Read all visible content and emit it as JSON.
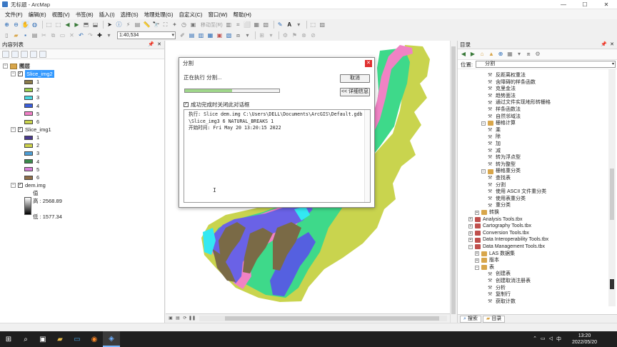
{
  "window": {
    "title": "无标题 - ArcMap",
    "controls": [
      "—",
      "☐",
      "✕"
    ]
  },
  "menu": [
    "文件(F)",
    "编辑(E)",
    "视图(V)",
    "书签(B)",
    "插入(I)",
    "选择(S)",
    "地理处理(G)",
    "自定义(C)",
    "窗口(W)",
    "帮助(H)"
  ],
  "toolbar": {
    "scale": "1:40,534",
    "mover_label": "移动至(R)"
  },
  "toc": {
    "title": "内容列表",
    "root": "图层",
    "layers": [
      {
        "name": "Slice_img2",
        "selected": true,
        "classes": [
          "1",
          "2",
          "3",
          "4",
          "5",
          "6"
        ],
        "colors": [
          "#8b7b4a",
          "#9dcf52",
          "#4ad7e0",
          "#3a5edc",
          "#f280c8",
          "#c9d44e"
        ]
      },
      {
        "name": "Slice_img1",
        "selected": false,
        "classes": [
          "1",
          "2",
          "3",
          "4",
          "5",
          "6"
        ],
        "colors": [
          "#4a3a8f",
          "#cdd24a",
          "#4da0d8",
          "#3a8a4c",
          "#d77ed8",
          "#8f6f48"
        ]
      }
    ],
    "dem": {
      "name": "dem.img",
      "value_label": "值",
      "high": "高 : 2568.89",
      "low": "低 : 1577.34"
    }
  },
  "dialog": {
    "title": "分割",
    "status": "正在执行 分割...",
    "cancel": "取消",
    "details": "<< 详细信息",
    "progress": 0.5,
    "close_on_success": "成功完成时关闭此对话框",
    "log": [
      "执行: Slice dem.img C:\\Users\\DELL\\Documents\\ArcGIS\\Default.gdb",
      "\\Slice_img3 6 NATURAL_BREAKS 1",
      "开始时间: Fri May 20 13:20:15 2022"
    ]
  },
  "catalog": {
    "title": "目录",
    "location_label": "位置:",
    "location_value": "分割",
    "tabs": [
      "搜索",
      "目录"
    ],
    "items": [
      {
        "label": "反距离权重法",
        "kind": "tool",
        "indent": 4
      },
      {
        "label": "含障碍的样条函数",
        "kind": "tool",
        "indent": 4
      },
      {
        "label": "克里金法",
        "kind": "tool",
        "indent": 4
      },
      {
        "label": "趋势面法",
        "kind": "tool",
        "indent": 4
      },
      {
        "label": "通过文件实现地形转栅格",
        "kind": "tool",
        "indent": 4
      },
      {
        "label": "样条函数法",
        "kind": "tool",
        "indent": 4
      },
      {
        "label": "自然邻域法",
        "kind": "tool",
        "indent": 4
      },
      {
        "label": "栅格计算",
        "kind": "set",
        "indent": 3,
        "exp": "−"
      },
      {
        "label": "乘",
        "kind": "tool",
        "indent": 4
      },
      {
        "label": "除",
        "kind": "tool",
        "indent": 4
      },
      {
        "label": "加",
        "kind": "tool",
        "indent": 4
      },
      {
        "label": "减",
        "kind": "tool",
        "indent": 4
      },
      {
        "label": "转为浮点型",
        "kind": "tool",
        "indent": 4
      },
      {
        "label": "转为整型",
        "kind": "tool",
        "indent": 4
      },
      {
        "label": "栅格重分类",
        "kind": "set",
        "indent": 3,
        "exp": "−"
      },
      {
        "label": "查找表",
        "kind": "tool",
        "indent": 4
      },
      {
        "label": "分割",
        "kind": "tool",
        "indent": 4
      },
      {
        "label": "使用 ASCII 文件重分类",
        "kind": "tool",
        "indent": 4
      },
      {
        "label": "使用表重分类",
        "kind": "tool",
        "indent": 4
      },
      {
        "label": "重分类",
        "kind": "tool",
        "indent": 4
      },
      {
        "label": "转换",
        "kind": "set",
        "indent": 2,
        "exp": "+"
      },
      {
        "label": "Analysis Tools.tbx",
        "kind": "tbx",
        "indent": 1,
        "exp": "+"
      },
      {
        "label": "Cartography Tools.tbx",
        "kind": "tbx",
        "indent": 1,
        "exp": "+"
      },
      {
        "label": "Conversion Tools.tbx",
        "kind": "tbx",
        "indent": 1,
        "exp": "+"
      },
      {
        "label": "Data Interoperability Tools.tbx",
        "kind": "tbx",
        "indent": 1,
        "exp": "+"
      },
      {
        "label": "Data Management Tools.tbx",
        "kind": "tbx",
        "indent": 1,
        "exp": "−"
      },
      {
        "label": "LAS 数据集",
        "kind": "set",
        "indent": 2,
        "exp": "+"
      },
      {
        "label": "版本",
        "kind": "set",
        "indent": 2,
        "exp": "+"
      },
      {
        "label": "表",
        "kind": "set",
        "indent": 2,
        "exp": "−"
      },
      {
        "label": "创建表",
        "kind": "tool",
        "indent": 4
      },
      {
        "label": "创建取消注册表",
        "kind": "tool",
        "indent": 4
      },
      {
        "label": "分析",
        "kind": "tool",
        "indent": 4
      },
      {
        "label": "复制行",
        "kind": "tool",
        "indent": 4
      },
      {
        "label": "获取计数",
        "kind": "tool",
        "indent": 4
      }
    ]
  },
  "taskbar": {
    "time": "13:20",
    "date": "2022/05/20",
    "lang": "中",
    "apps": [
      "⊞",
      "⌕",
      "▣",
      "▰",
      "▭",
      "◉",
      "◈"
    ]
  }
}
